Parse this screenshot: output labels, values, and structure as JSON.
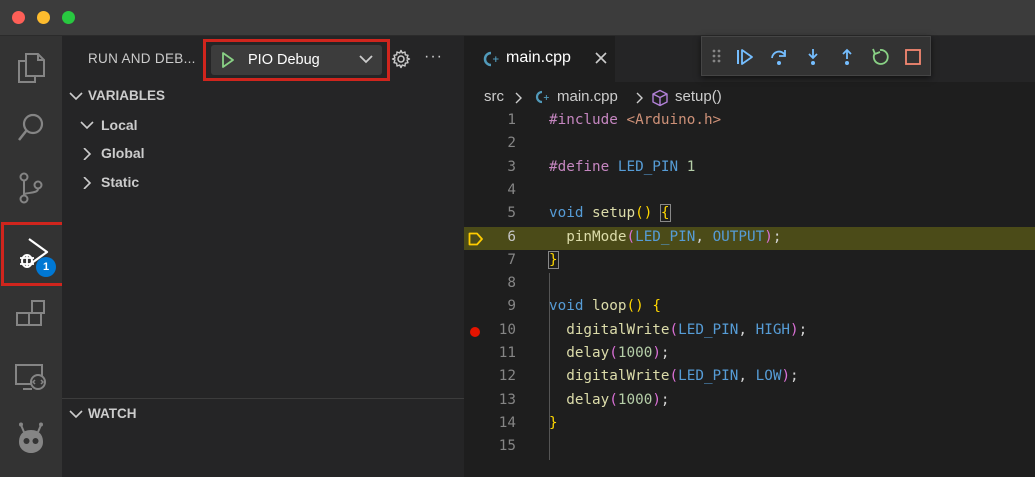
{
  "sidebar": {
    "title": "RUN AND DEB...",
    "config": "PIO Debug",
    "more": "···",
    "sections": {
      "variables": "VARIABLES",
      "watch": "WATCH"
    },
    "scopes": [
      "Local",
      "Global",
      "Static"
    ]
  },
  "activity_bar": {
    "badge": "1",
    "items": [
      "explorer-icon",
      "search-icon",
      "source-control-icon",
      "run-debug-icon",
      "extensions-icon",
      "remote-explorer-icon",
      "platformio-icon"
    ]
  },
  "editor": {
    "tab": "main.cpp",
    "breadcrumb": {
      "folder": "src",
      "file": "main.cpp",
      "symbol": "setup()"
    },
    "current_line": 6,
    "breakpoint_line": 10,
    "line_numbers": [
      "1",
      "2",
      "3",
      "4",
      "5",
      "6",
      "7",
      "8",
      "9",
      "10",
      "11",
      "12",
      "13",
      "14",
      "15"
    ]
  },
  "debug_toolbar": [
    "continue",
    "step-over",
    "step-into",
    "step-out",
    "restart",
    "stop"
  ],
  "colors": {
    "accent_highlight": "#d0251d",
    "current_line": "#4b4b18",
    "breakpoint": "#e51400",
    "badge": "#0078d4"
  }
}
